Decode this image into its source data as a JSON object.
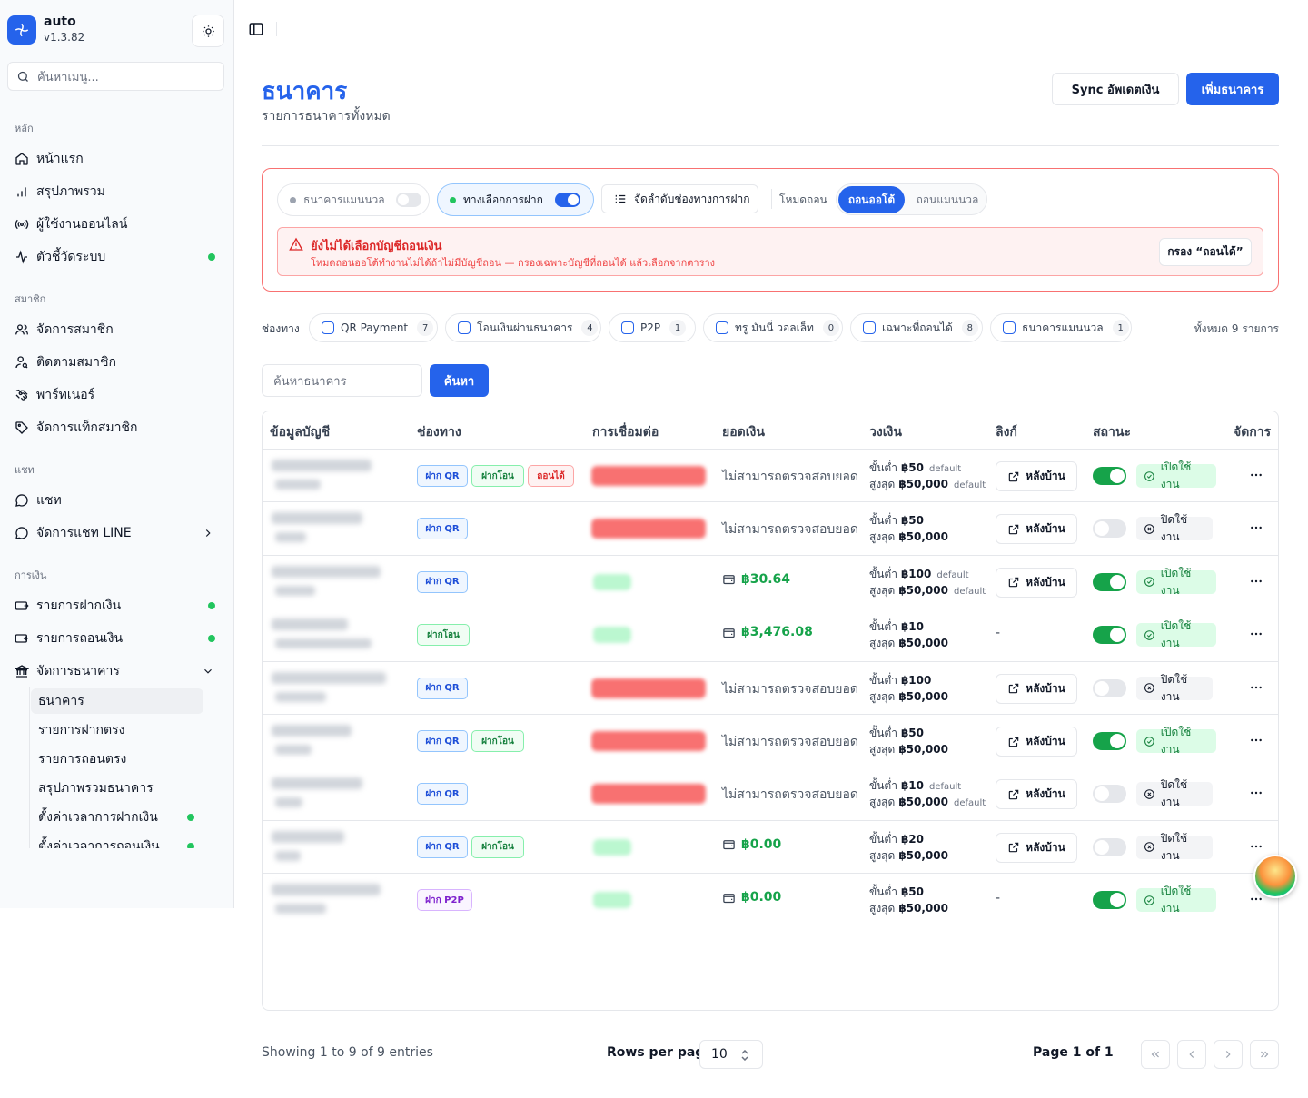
{
  "brand": {
    "name": "auto",
    "version": "v1.3.82"
  },
  "sidebar": {
    "search_placeholder": "ค้นหาเมนู...",
    "groups": {
      "main": "หลัก",
      "members": "สมาชิก",
      "chat": "แชท",
      "finance": "การเงิน"
    },
    "items": {
      "home": "หน้าแรก",
      "overview": "สรุปภาพรวม",
      "online_users": "ผู้ใช้งานออนไลน์",
      "system_metrics": "ตัวชี้วัดระบบ",
      "manage_members": "จัดการสมาชิก",
      "track_members": "ติดตามสมาชิก",
      "partners": "พาร์ทเนอร์",
      "member_tags": "จัดการแท็กสมาชิก",
      "chat": "แชท",
      "line_chat": "จัดการแชท LINE",
      "deposits": "รายการฝากเงิน",
      "withdrawals": "รายการถอนเงิน",
      "manage_banks": "จัดการธนาคาร"
    },
    "sub_items": {
      "banks": "ธนาคาร",
      "direct_deposits": "รายการฝากตรง",
      "direct_withdrawals": "รายการถอนตรง",
      "bank_summary": "สรุปภาพรวมธนาคาร",
      "deposit_times": "ตั้งค่าเวลาการฝากเงิน",
      "withdraw_times": "ตั้งค่าเวลาการถอนเงิน"
    }
  },
  "page": {
    "title": "ธนาคาร",
    "subtitle": "รายการธนาคารทั้งหมด",
    "sync_button": "Sync อัพเดตเงิน",
    "add_button": "เพิ่มธนาคาร"
  },
  "panel": {
    "manual_bank": "ธนาคารแมนนวล",
    "deposit_option": "ทางเลือกการฝาก",
    "order_channels": "จัดลำดับช่องทางการฝาก",
    "withdraw_mode_label": "โหมดถอน",
    "mode_auto": "ถอนออโต้",
    "mode_manual": "ถอนแมนนวล",
    "warning_title": "ยังไม่ได้เลือกบัญชีถอนเงิน",
    "warning_desc": "โหมดถอนออโต้ทำงานไม่ได้ถ้าไม่มีบัญชีถอน — กรองเฉพาะบัญชีที่ถอนได้ แล้วเลือกจากตาราง",
    "filter_button": "กรอง “ถอนได้”"
  },
  "channels": {
    "label": "ช่องทาง",
    "items": [
      {
        "label": "QR Payment",
        "count": "7"
      },
      {
        "label": "โอนเงินผ่านธนาคาร",
        "count": "4"
      },
      {
        "label": "P2P",
        "count": "1"
      },
      {
        "label": "ทรู มันนี่ วอลเล็ท",
        "count": "0"
      },
      {
        "label": "เฉพาะที่ถอนได้",
        "count": "8"
      },
      {
        "label": "ธนาคารแมนนวล",
        "count": "1"
      }
    ],
    "total": "ทั้งหมด 9 รายการ"
  },
  "search": {
    "placeholder": "ค้นหาธนาคาร",
    "button": "ค้นหา"
  },
  "table": {
    "headers": {
      "account": "ข้อมูลบัญชี",
      "channel": "ช่องทาง",
      "connection": "การเชื่อมต่อ",
      "balance": "ยอดเงิน",
      "limit": "วงเงิน",
      "link": "ลิงก์",
      "status": "สถานะ",
      "manage": "จัดการ"
    },
    "labels": {
      "min": "ขั้นต่ำ",
      "max": "สูงสุด",
      "default": "default",
      "backend": "หลังบ้าน",
      "on": "เปิดใช้งาน",
      "off": "ปิดใช้งาน",
      "cannot_check": "ไม่สามารถตรวจสอบยอด",
      "dash": "-"
    },
    "tags": {
      "qr": "ฝาก QR",
      "transfer": "ฝากโอน",
      "withdraw": "ถอนได้",
      "p2p": "ฝาก P2P"
    },
    "rows": [
      {
        "tags": [
          "qr",
          "transfer",
          "withdraw"
        ],
        "conn": "error",
        "balance": "",
        "min": "฿50",
        "max": "฿50,000",
        "min_default": true,
        "max_default": true,
        "link": true,
        "active": true
      },
      {
        "tags": [
          "qr"
        ],
        "conn": "error",
        "balance": "",
        "min": "฿50",
        "max": "฿50,000",
        "min_default": false,
        "max_default": false,
        "link": true,
        "active": false
      },
      {
        "tags": [
          "qr"
        ],
        "conn": "ok",
        "balance": "฿30.64",
        "min": "฿100",
        "max": "฿50,000",
        "min_default": true,
        "max_default": true,
        "link": true,
        "active": true
      },
      {
        "tags": [
          "transfer"
        ],
        "conn": "ok",
        "balance": "฿3,476.08",
        "min": "฿10",
        "max": "฿50,000",
        "min_default": false,
        "max_default": false,
        "link": false,
        "active": true
      },
      {
        "tags": [
          "qr"
        ],
        "conn": "error",
        "balance": "",
        "min": "฿100",
        "max": "฿50,000",
        "min_default": false,
        "max_default": false,
        "link": true,
        "active": false
      },
      {
        "tags": [
          "qr",
          "transfer"
        ],
        "conn": "error",
        "balance": "",
        "min": "฿50",
        "max": "฿50,000",
        "min_default": false,
        "max_default": false,
        "link": true,
        "active": true
      },
      {
        "tags": [
          "qr"
        ],
        "conn": "error",
        "balance": "",
        "min": "฿10",
        "max": "฿50,000",
        "min_default": true,
        "max_default": true,
        "link": true,
        "active": false
      },
      {
        "tags": [
          "qr",
          "transfer"
        ],
        "conn": "ok",
        "balance": "฿0.00",
        "min": "฿20",
        "max": "฿50,000",
        "min_default": false,
        "max_default": false,
        "link": true,
        "active": false
      },
      {
        "tags": [
          "p2p"
        ],
        "conn": "ok",
        "balance": "฿0.00",
        "min": "฿50",
        "max": "฿50,000",
        "min_default": false,
        "max_default": false,
        "link": false,
        "active": true
      }
    ]
  },
  "footer": {
    "showing": "Showing 1 to 9 of 9 entries",
    "rows_per_page_label": "Rows per page",
    "rows_per_page": "10",
    "page_of": "Page 1 of 1"
  },
  "colors": {
    "primary": "#2563eb",
    "success": "#16a34a",
    "danger": "#dc2626"
  }
}
